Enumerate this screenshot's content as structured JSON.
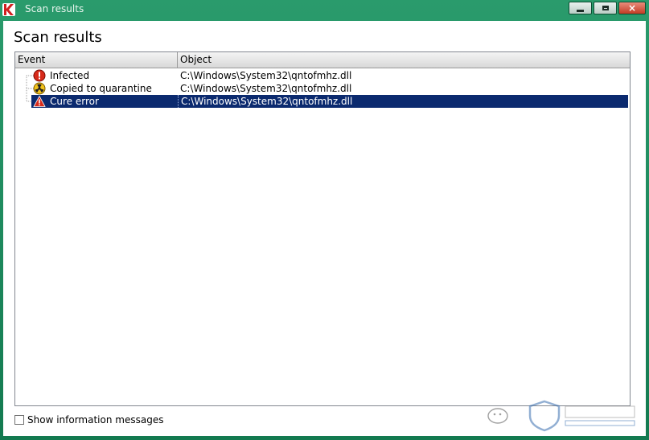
{
  "window": {
    "title": "Scan results",
    "controls": {
      "minimize": "minimize",
      "maximize": "maximize",
      "close": "×"
    }
  },
  "page": {
    "title": "Scan results"
  },
  "list": {
    "columns": {
      "event": "Event",
      "object": "Object"
    },
    "rows": [
      {
        "event": "Infected",
        "object": "C:\\Windows\\System32\\qntofmhz.dll",
        "icon": "infected-icon",
        "selected": false
      },
      {
        "event": "Copied to quarantine",
        "object": "C:\\Windows\\System32\\qntofmhz.dll",
        "icon": "quarantine-icon",
        "selected": false
      },
      {
        "event": "Cure error",
        "object": "C:\\Windows\\System32\\qntofmhz.dll",
        "icon": "warning-icon",
        "selected": true
      }
    ]
  },
  "footer": {
    "show_info_label": "Show information messages",
    "show_info_checked": false
  },
  "colors": {
    "accent": "#1f8a5e",
    "selection": "#0b2a6f",
    "close": "#c33b24"
  }
}
